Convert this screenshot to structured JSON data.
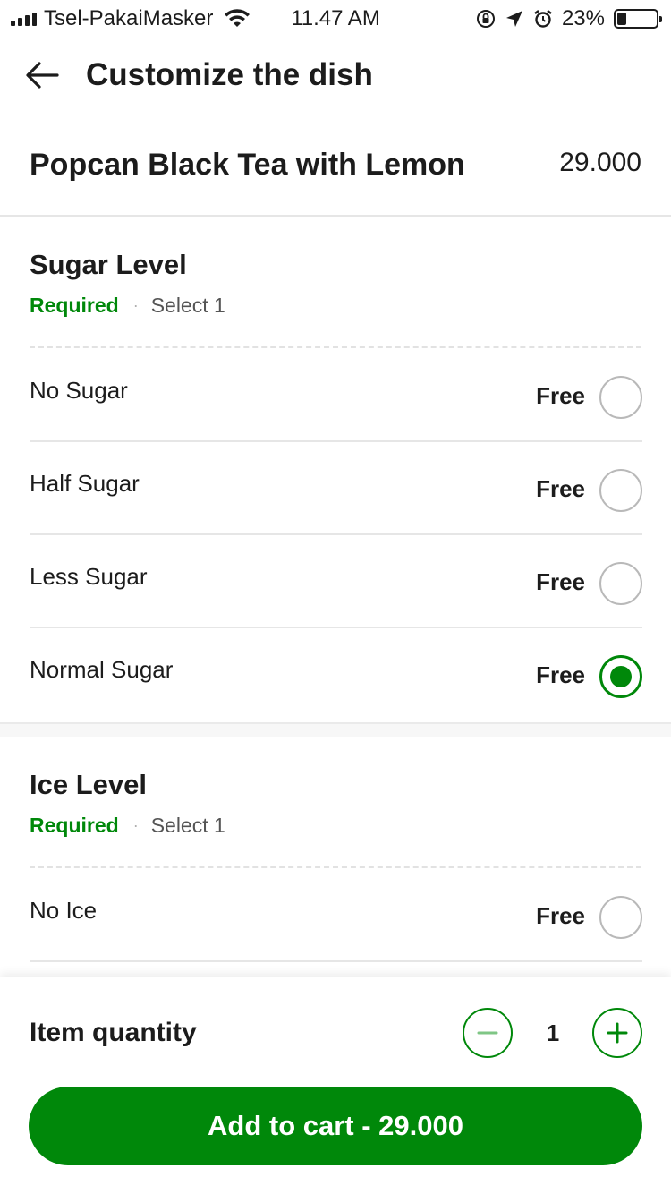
{
  "status_bar": {
    "carrier": "Tsel-PakaiMasker",
    "time": "11.47 AM",
    "battery": "23%",
    "battery_level": 0.23
  },
  "header": {
    "title": "Customize the dish",
    "back_icon": "arrow-left-icon"
  },
  "dish": {
    "name": "Popcan Black Tea with Lemon",
    "price": "29.000"
  },
  "sugar_group": {
    "title": "Sugar Level",
    "required": "Required",
    "separator": "·",
    "select": "Select 1",
    "options": [
      {
        "label": "No Sugar",
        "price": "Free",
        "selected": false
      },
      {
        "label": "Half Sugar",
        "price": "Free",
        "selected": false
      },
      {
        "label": "Less Sugar",
        "price": "Free",
        "selected": false
      },
      {
        "label": "Normal Sugar",
        "price": "Free",
        "selected": true
      }
    ]
  },
  "ice_group": {
    "title": "Ice Level",
    "required": "Required",
    "separator": "·",
    "select": "Select 1",
    "options": [
      {
        "label": "No Ice",
        "price": "Free",
        "selected": false
      }
    ]
  },
  "footer": {
    "quantity_label": "Item quantity",
    "quantity": "1",
    "add_to_cart": "Add to cart - 29.000",
    "accent_color": "#00880a"
  }
}
